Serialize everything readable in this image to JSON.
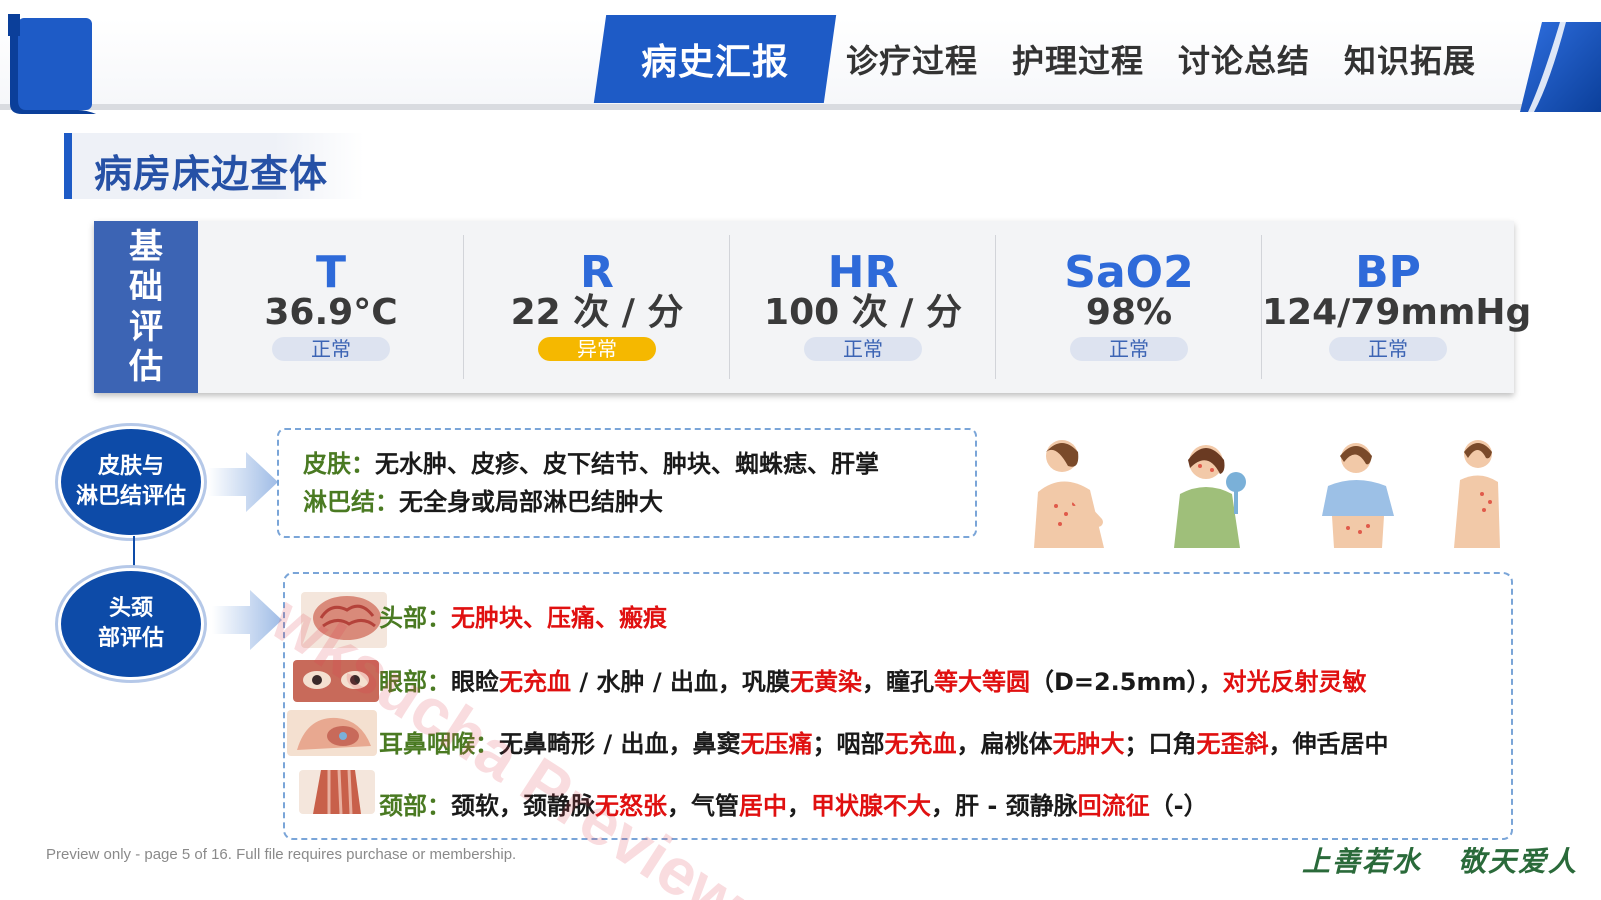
{
  "nav": {
    "active": "病史汇报",
    "items": [
      "诊疗过程",
      "护理过程",
      "讨论总结",
      "知识拓展"
    ]
  },
  "section_title": "病房床边查体",
  "vitals": {
    "side_label": [
      "基",
      "础",
      "评",
      "估"
    ],
    "items": [
      {
        "label": "T",
        "value": "36.9°C",
        "status": "正常",
        "abnormal": false
      },
      {
        "label": "R",
        "value": "22 次 / 分",
        "status": "异常",
        "abnormal": true
      },
      {
        "label": "HR",
        "value": "100 次 / 分",
        "status": "正常",
        "abnormal": false
      },
      {
        "label": "SaO2",
        "value": "98%",
        "status": "正常",
        "abnormal": false
      },
      {
        "label": "BP",
        "value": "124/79mmHg",
        "status": "正常",
        "abnormal": false
      }
    ]
  },
  "skin_section": {
    "circle_label": [
      "皮肤与",
      "淋巴结评估"
    ],
    "skin_label": "皮肤：",
    "skin_text": "无水肿、皮疹、皮下结节、肿块、蜘蛛痣、肝掌",
    "lymph_label": "淋巴结：",
    "lymph_text": "无全身或局部淋巴结肿大"
  },
  "head_section": {
    "circle_label": [
      "头颈",
      "部评估"
    ],
    "head": {
      "label": "头部：",
      "red": "无肿块、压痛、瘢痕"
    },
    "eye": {
      "label": "眼部：",
      "t1": "眼睑",
      "r1": "无充血",
      "t2": " / 水肿 / 出血，巩膜",
      "r2": "无黄染",
      "t3": "，瞳孔",
      "r3": "等大等圆",
      "t4": "（D=2.5mm），",
      "r4": "对光反射灵敏"
    },
    "ent": {
      "label": "耳鼻咽喉：",
      "t1": "无鼻畸形 / 出血，鼻窦",
      "r1": "无压痛",
      "t2": "；咽部",
      "r2": "无充血",
      "t3": "，扁桃体",
      "r3": "无肿大",
      "t4": "；口角",
      "r4": "无歪斜",
      "t5": "，伸舌居中"
    },
    "neck": {
      "label": "颈部：",
      "t1": "颈软，颈静脉",
      "r1": "无怒张",
      "t2": "，气管",
      "r2": "居中",
      "t3": "，",
      "r3": "甲状腺不大",
      "t4": "，肝 - 颈静脉",
      "r4": "回流征",
      "t5": "（-）"
    }
  },
  "footer": {
    "note": "Preview only - page 5 of 16. Full file requires purchase or membership.",
    "motto_left": "上善若水",
    "motto_right": "敬天爱人"
  },
  "watermark": "wksucha Preview",
  "colors": {
    "primary": "#1e5bc6",
    "circle": "#0d4ba8",
    "label_green": "#4a7a22",
    "highlight_red": "#e01010",
    "abnormal_badge": "#f5b800"
  },
  "icons": [
    "scroll-logo-icon",
    "arrow-right-icon",
    "person-illustration-icon",
    "anatomy-thumbnail-icon"
  ]
}
